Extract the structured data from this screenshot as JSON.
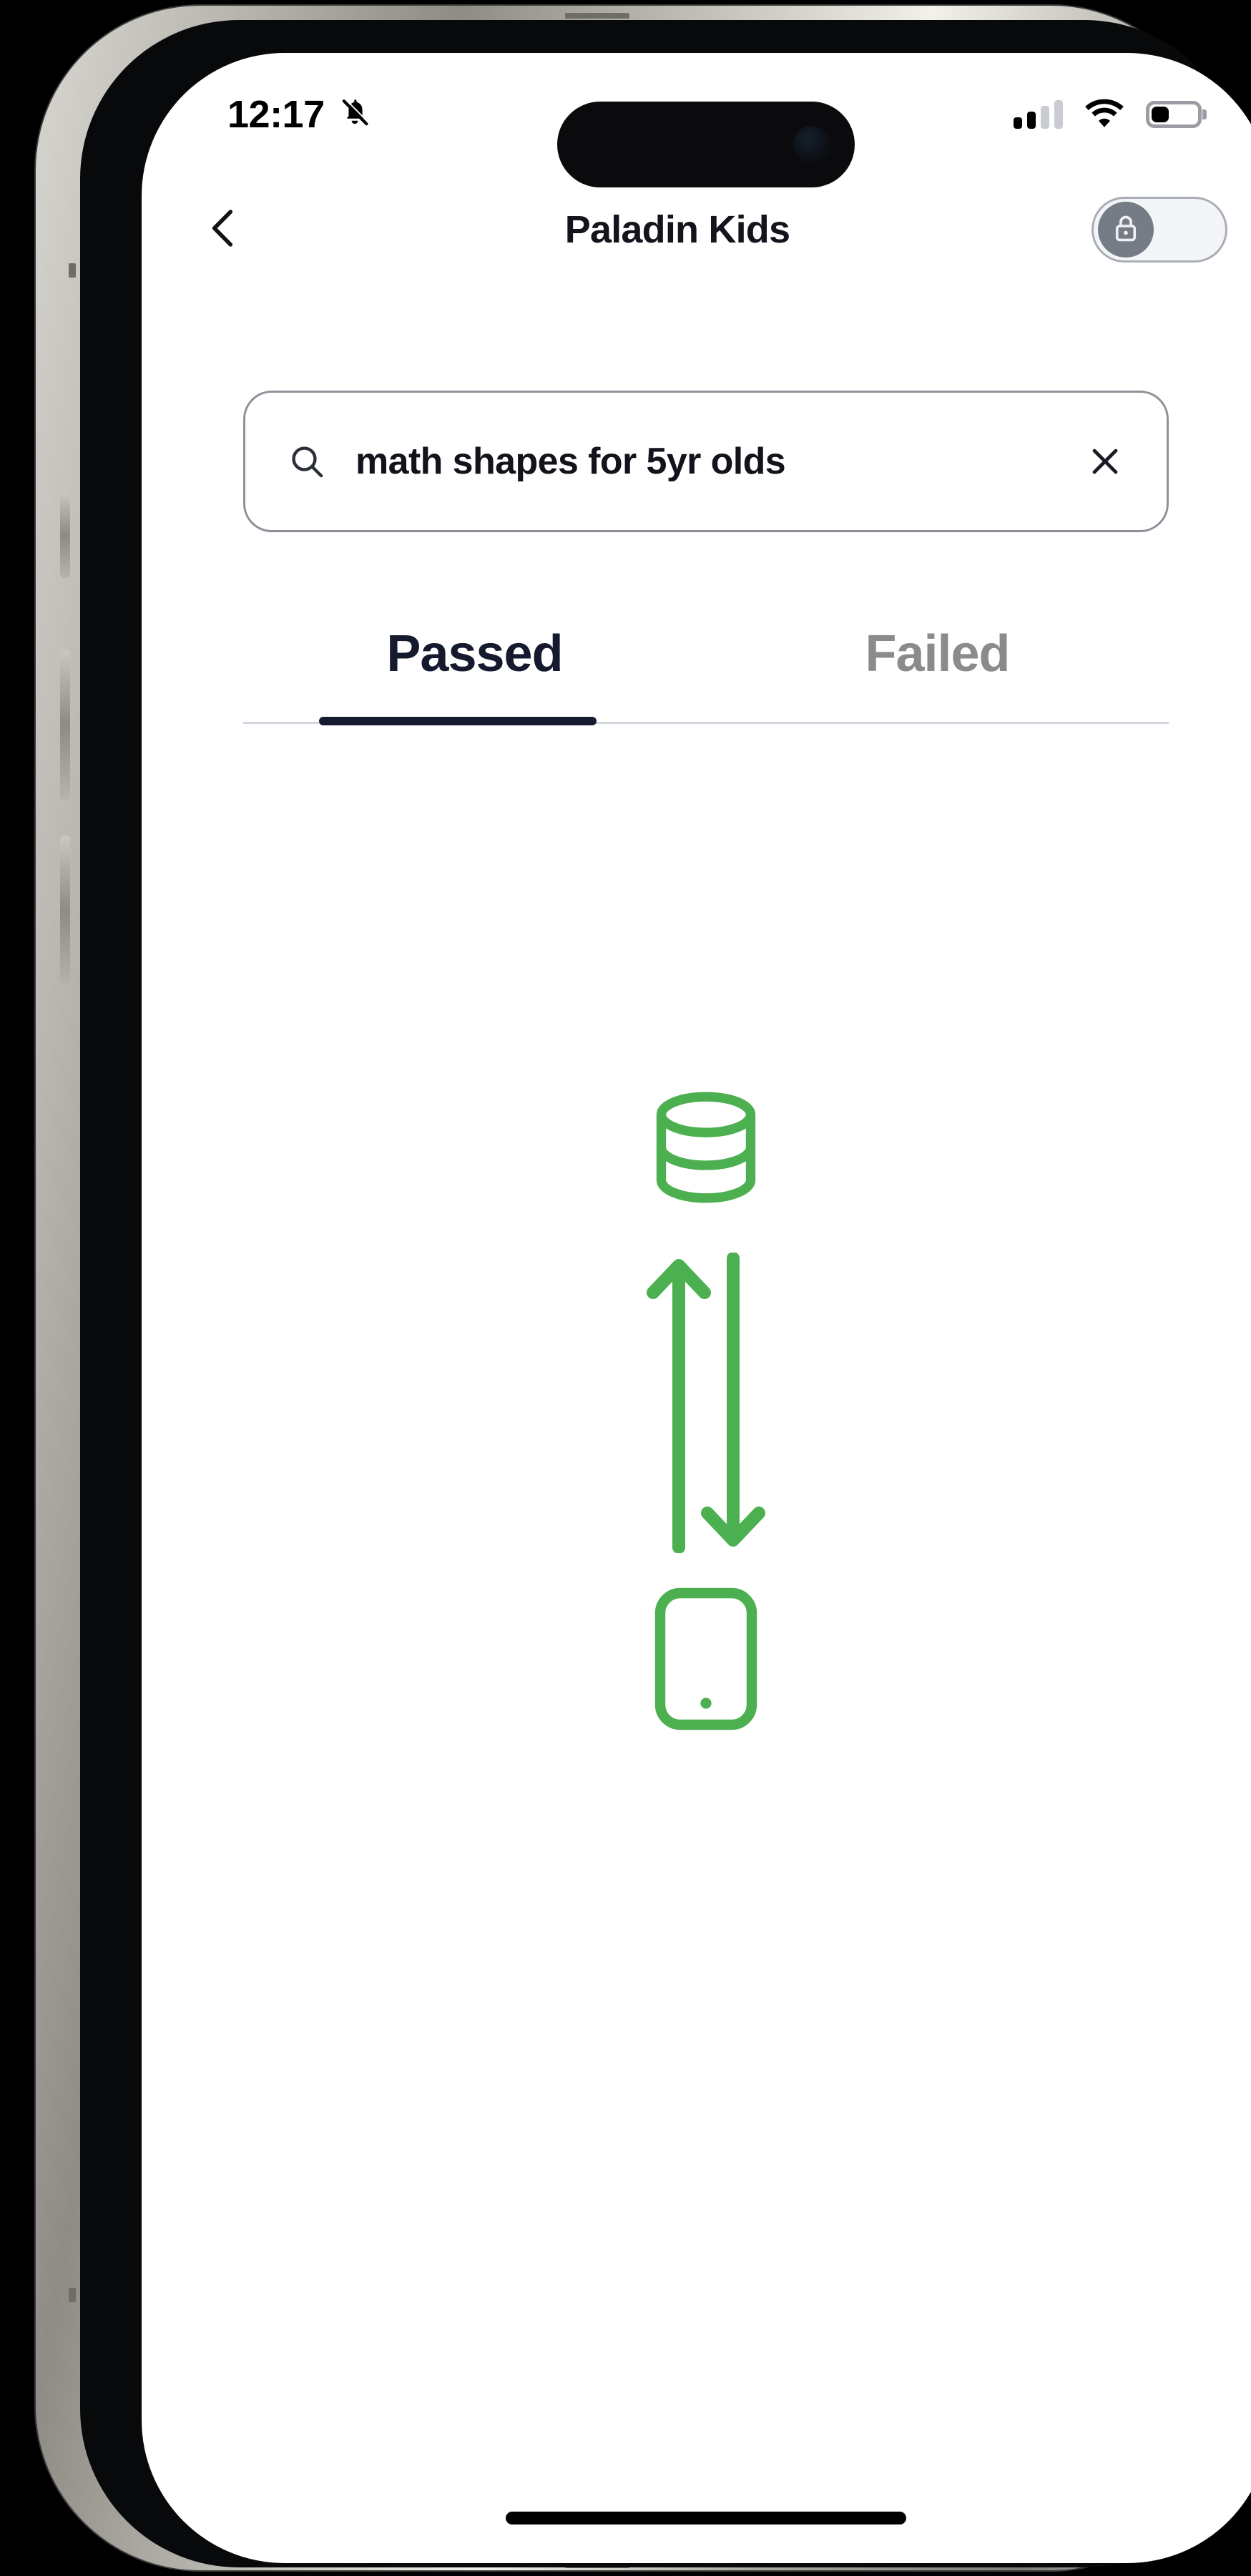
{
  "device": {
    "kind": "iphone-mockup",
    "screen_background": "#ffffff"
  },
  "status_bar": {
    "time": "12:17",
    "silent_icon": "bell-slash-icon",
    "signal_icon": "cellular-signal-icon",
    "signal_bars_active": 2,
    "signal_bars_total": 4,
    "wifi_icon": "wifi-icon",
    "battery_icon": "battery-icon",
    "battery_level_percent": 36
  },
  "nav": {
    "back_icon": "chevron-left-icon",
    "title": "Paladin Kids",
    "lock_toggle": {
      "icon": "lock-icon",
      "state": "off",
      "knob_color": "#757c86",
      "track_color": "#f4f5f9"
    }
  },
  "search": {
    "icon": "search-icon",
    "value": "math shapes for 5yr olds",
    "placeholder": "Search",
    "clear_icon": "close-x-icon",
    "border_color": "#8d9199"
  },
  "tabs": {
    "items": [
      {
        "label": "Passed",
        "active": true
      },
      {
        "label": "Failed",
        "active": false
      }
    ],
    "active_color": "#151a2e",
    "inactive_color": "#8b8b8b",
    "divider_color": "#d3d6de"
  },
  "empty_state": {
    "accent_color": "#4caf50",
    "icons": [
      "database-cylinder-icon",
      "arrow-up-icon",
      "arrow-down-icon",
      "mobile-phone-icon"
    ],
    "message": ""
  },
  "home_indicator": {
    "color": "#000000"
  }
}
